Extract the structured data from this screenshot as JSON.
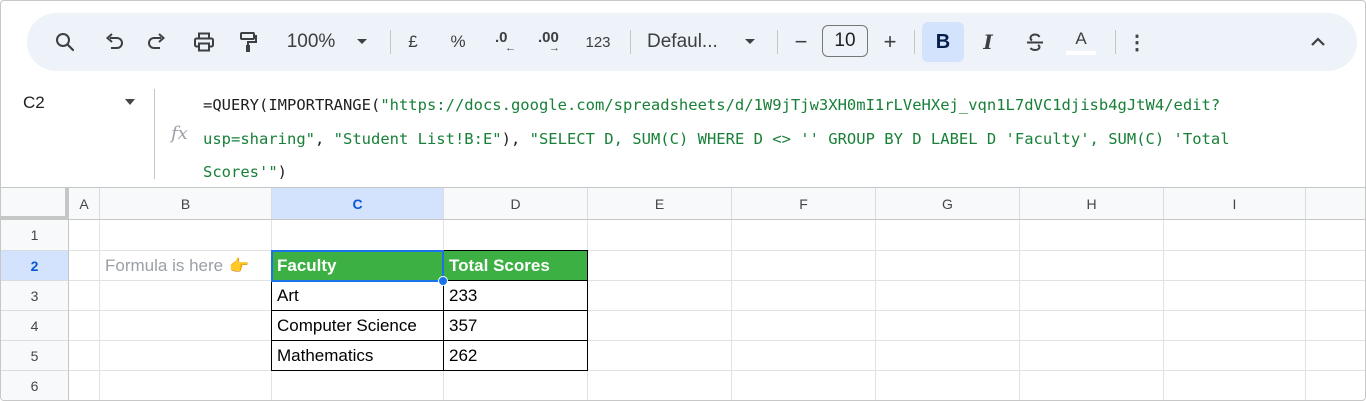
{
  "toolbar": {
    "zoom": "100%",
    "currency": "£",
    "percent": "%",
    "decimal_decrease": ".0",
    "decimal_increase": ".00",
    "number_format": "123",
    "font": "Defaul...",
    "font_size": "10",
    "minus": "−",
    "plus": "+",
    "bold": "B",
    "italic": "I",
    "text_color": "A",
    "more": "⋮",
    "collapse": "^",
    "icons": [
      "search-icon",
      "undo-icon",
      "redo-icon",
      "print-icon",
      "paint-format-icon",
      "chevron-down-icon",
      "strikethrough-icon",
      "more-vert-icon",
      "chevron-up-icon"
    ]
  },
  "formula_bar": {
    "cell_ref": "C2",
    "fx": "fx",
    "line1_prefix": "=QUERY(IMPORTRANGE(",
    "line1_url": "\"https://docs.google.com/spreadsheets/d/1W9jTjw3XH0mI1rLVeHXej_vqn1L7dVC1djisb4gJtW4/edit?",
    "line2_a": "usp=sharing\"",
    "line2_b": ", ",
    "line2_c": "\"Student List!B:E\"",
    "line2_d": "), ",
    "line2_e": "\"SELECT D, SUM(C) WHERE D <> '' GROUP BY D LABEL D 'Faculty', SUM(C) 'Total",
    "line3_a": "Scores'\"",
    "line3_b": ")"
  },
  "grid": {
    "columns": [
      "A",
      "B",
      "C",
      "D",
      "E",
      "F",
      "G",
      "H",
      "I"
    ],
    "selected_column": "C",
    "rows": [
      "1",
      "2",
      "3",
      "4",
      "5",
      "6"
    ],
    "selected_row": "2",
    "note": "Formula is here",
    "note_icon": "👉",
    "table": {
      "headers": [
        "Faculty",
        "Total Scores"
      ],
      "rows": [
        [
          "Art",
          "233"
        ],
        [
          "Computer Science",
          "357"
        ],
        [
          "Mathematics",
          "262"
        ]
      ]
    }
  },
  "colors": {
    "header_fill": "#3cb043",
    "selection": "#1a73e8",
    "formula_string": "#188038",
    "toolbar_bg": "#eef2f9"
  }
}
